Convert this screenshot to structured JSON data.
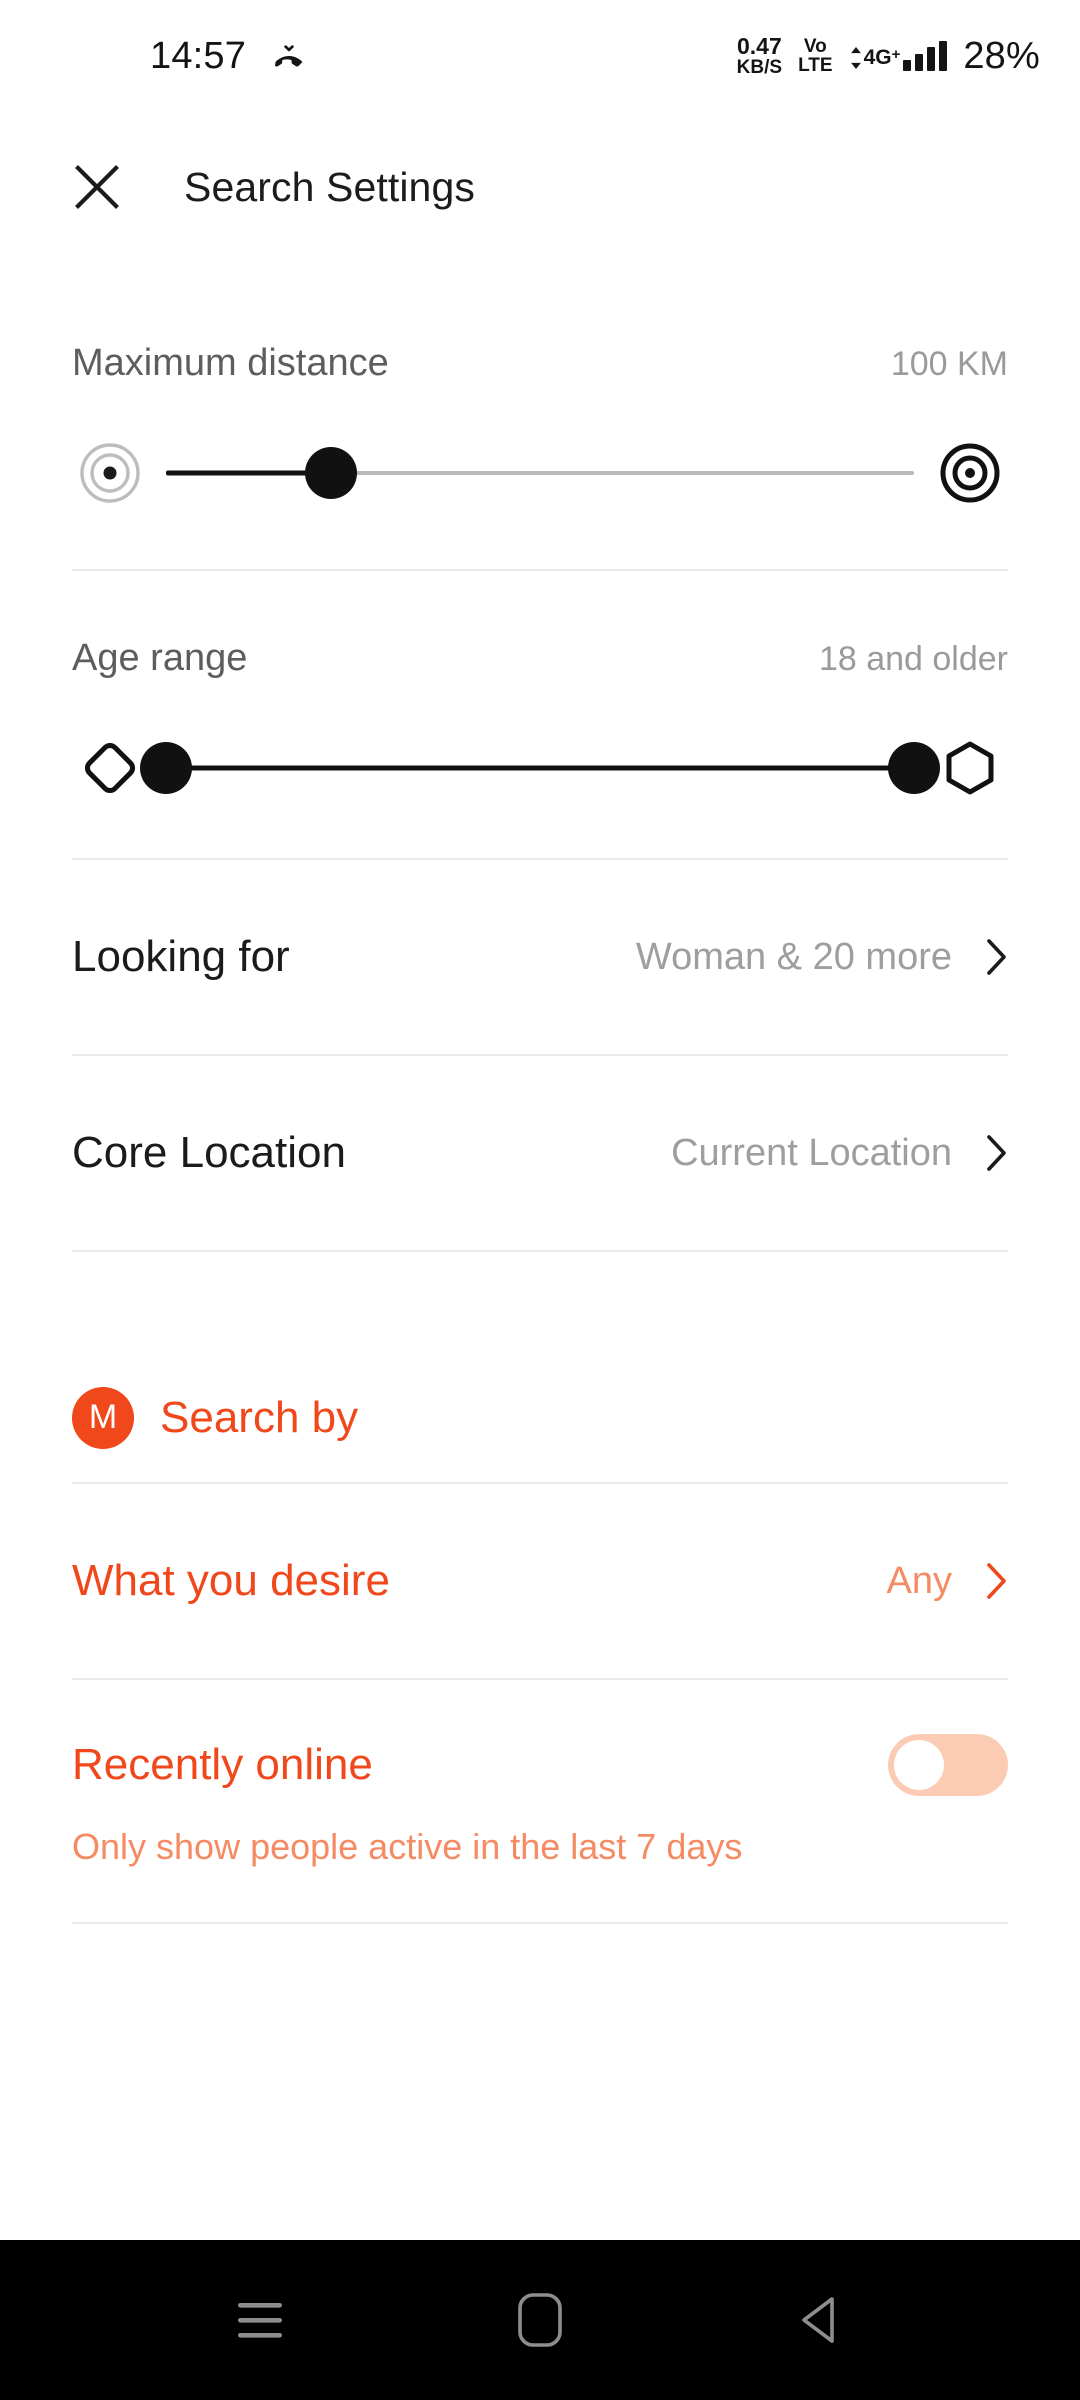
{
  "status_bar": {
    "clock": "14:57",
    "missed_call_icon": "missed-call-icon",
    "net_speed_value": "0.47",
    "net_speed_unit": "KB/S",
    "volte_top": "Vo",
    "volte_bottom": "LTE",
    "network_type": "4G",
    "network_plus": "+",
    "battery": "28%"
  },
  "header": {
    "close_icon": "close-icon",
    "title": "Search Settings"
  },
  "distance": {
    "label": "Maximum distance",
    "value": "100 KM",
    "left_icon": "target-small-icon",
    "right_icon": "target-large-icon",
    "thumb_percent": 22
  },
  "age": {
    "label": "Age range",
    "value": "18 and older",
    "left_icon": "diamond-icon",
    "right_icon": "hexagon-icon",
    "low_percent": 0,
    "high_percent": 100
  },
  "rows": [
    {
      "title": "Looking for",
      "value": "Woman & 20 more",
      "chevron_icon": "chevron-right-icon"
    },
    {
      "title": "Core Location",
      "value": "Current Location",
      "chevron_icon": "chevron-right-icon"
    }
  ],
  "search_by": {
    "badge_letter": "M",
    "badge_icon": "premium-m-badge-icon",
    "title": "Search by"
  },
  "desire_row": {
    "title": "What you desire",
    "value": "Any",
    "chevron_icon": "chevron-right-icon"
  },
  "recently_online": {
    "title": "Recently online",
    "subtitle": "Only show people active in the last 7 days",
    "enabled": false
  },
  "system_nav": {
    "recents_icon": "recents-menu-icon",
    "home_icon": "home-square-icon",
    "back_icon": "back-triangle-icon"
  },
  "colors": {
    "accent": "#f0471b",
    "accent_light": "#f58a63",
    "toggle_track_off": "#fbcbb4",
    "divider": "#e9e9e9",
    "muted_text": "#9e9e9e"
  }
}
